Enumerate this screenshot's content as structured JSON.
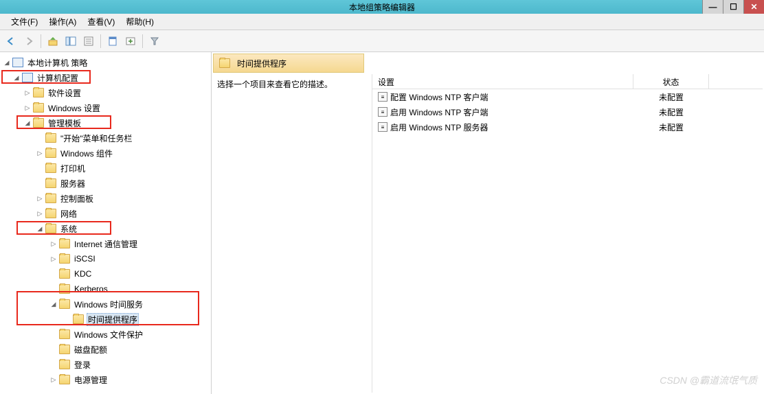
{
  "titlebar": {
    "title": "本地组策略编辑器"
  },
  "menubar": {
    "file": "文件(F)",
    "action": "操作(A)",
    "view": "查看(V)",
    "help": "帮助(H)"
  },
  "tree": {
    "root": "本地计算机 策略",
    "n1": "计算机配置",
    "n2": "软件设置",
    "n3": "Windows 设置",
    "n4": "管理模板",
    "n5": "\"开始\"菜单和任务栏",
    "n6": "Windows 组件",
    "n7": "打印机",
    "n8": "服务器",
    "n9": "控制面板",
    "n10": "网络",
    "n11": "系统",
    "n12": "Internet 通信管理",
    "n13": "iSCSI",
    "n14": "KDC",
    "n15": "Kerberos",
    "n16": "Windows 时间服务",
    "n17": "时间提供程序",
    "n18": "Windows 文件保护",
    "n19": "磁盘配额",
    "n20": "登录",
    "n21": "电源管理"
  },
  "right": {
    "header_title": "时间提供程序",
    "desc_prompt": "选择一个项目来查看它的描述。",
    "columns": {
      "setting": "设置",
      "state": "状态"
    },
    "rows": [
      {
        "name": "配置 Windows NTP 客户端",
        "state": "未配置"
      },
      {
        "name": "启用 Windows NTP 客户端",
        "state": "未配置"
      },
      {
        "name": "启用 Windows NTP 服务器",
        "state": "未配置"
      }
    ]
  },
  "watermark": "CSDN @霸道流氓气质"
}
